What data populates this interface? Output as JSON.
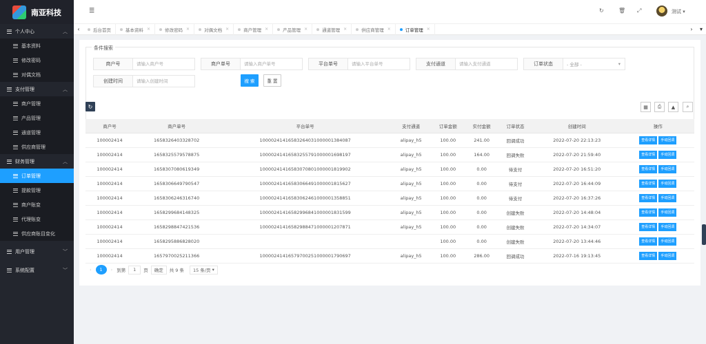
{
  "app": {
    "brand": "南亚科技"
  },
  "sidebar": {
    "groups": [
      {
        "label": "个人中心",
        "items": [
          "基本资料",
          "修改密码",
          "对偶文档"
        ]
      },
      {
        "label": "支付管理",
        "items": [
          "商户管理",
          "产品管理",
          "通道管理",
          "供应商管理"
        ]
      },
      {
        "label": "财务管理",
        "items": [
          "订单管理",
          "提款管理",
          "商户账变",
          "代理账变",
          "供应商账目变化"
        ]
      },
      {
        "label": "用户管理",
        "items": []
      },
      {
        "label": "系统配置",
        "items": []
      }
    ],
    "active_item": "订单管理"
  },
  "header": {
    "user": "测试"
  },
  "tabs": [
    {
      "label": "后台首页"
    },
    {
      "label": "基本资料"
    },
    {
      "label": "修改密码"
    },
    {
      "label": "对偶文档"
    },
    {
      "label": "商户管理"
    },
    {
      "label": "产品管理"
    },
    {
      "label": "通道管理"
    },
    {
      "label": "供应商管理"
    },
    {
      "label": "订单管理"
    }
  ],
  "search": {
    "title": "条件搜索",
    "fields": [
      {
        "label": "商户号",
        "placeholder": "请输入商户号"
      },
      {
        "label": "商户单号",
        "placeholder": "请输入商户单号"
      },
      {
        "label": "平台单号",
        "placeholder": "请输入平台单号"
      },
      {
        "label": "支付通道",
        "placeholder": "请输入支付通道"
      },
      {
        "label": "订单状态",
        "value": "- 全部 -"
      },
      {
        "label": "创建时间",
        "placeholder": "请输入创建时间"
      }
    ],
    "search_label": "搜 索",
    "reset_label": "重 置"
  },
  "table": {
    "columns": [
      "商户号",
      "商户单号",
      "平台单号",
      "支付通道",
      "订单金额",
      "实付金额",
      "订单状态",
      "创建时间",
      "操作"
    ],
    "rows": [
      [
        "100002414",
        "1658326403328702",
        "10000241416583264031000001384087",
        "alipay_h5",
        "100.00",
        "241.00",
        "回调成功",
        "2022-07-20 22:13:23"
      ],
      [
        "100002414",
        "1658325579578875",
        "10000241416583255791000001698197",
        "alipay_h5",
        "100.00",
        "164.00",
        "回调失败",
        "2022-07-20 21:59:40"
      ],
      [
        "100002414",
        "1658307080619349",
        "10000241416583070801000001819902",
        "alipay_h5",
        "100.00",
        "0.00",
        "待支付",
        "2022-07-20 16:51:20"
      ],
      [
        "100002414",
        "1658306649790547",
        "10000241416583066491000001815627",
        "alipay_h5",
        "100.00",
        "0.00",
        "待支付",
        "2022-07-20 16:44:09"
      ],
      [
        "100002414",
        "1658306246316740",
        "10000241416583062461000001358851",
        "alipay_h5",
        "100.00",
        "0.00",
        "待支付",
        "2022-07-20 16:37:26"
      ],
      [
        "100002414",
        "1658299684148325",
        "10000241416582996841000001831599",
        "alipay_h5",
        "100.00",
        "0.00",
        "创建失败",
        "2022-07-20 14:48:04"
      ],
      [
        "100002414",
        "1658298847421536",
        "10000241416582988471000001207871",
        "alipay_h5",
        "100.00",
        "0.00",
        "创建失败",
        "2022-07-20 14:34:07"
      ],
      [
        "100002414",
        "1658295886828020",
        "",
        "",
        "100.00",
        "0.00",
        "创建失败",
        "2022-07-20 13:44:46"
      ],
      [
        "100002414",
        "1657970025211366",
        "10000241416579700251000001790697",
        "alipay_h5",
        "100.00",
        "286.00",
        "回调成功",
        "2022-07-16 19:13:45"
      ]
    ],
    "action_detail": "查看详情",
    "action_callback": "手动回调"
  },
  "pager": {
    "current": "1",
    "goto_label": "到第",
    "page_input": "1",
    "page_unit": "页",
    "confirm": "确定",
    "total": "共 9 条",
    "per_page": "15 条/页"
  }
}
